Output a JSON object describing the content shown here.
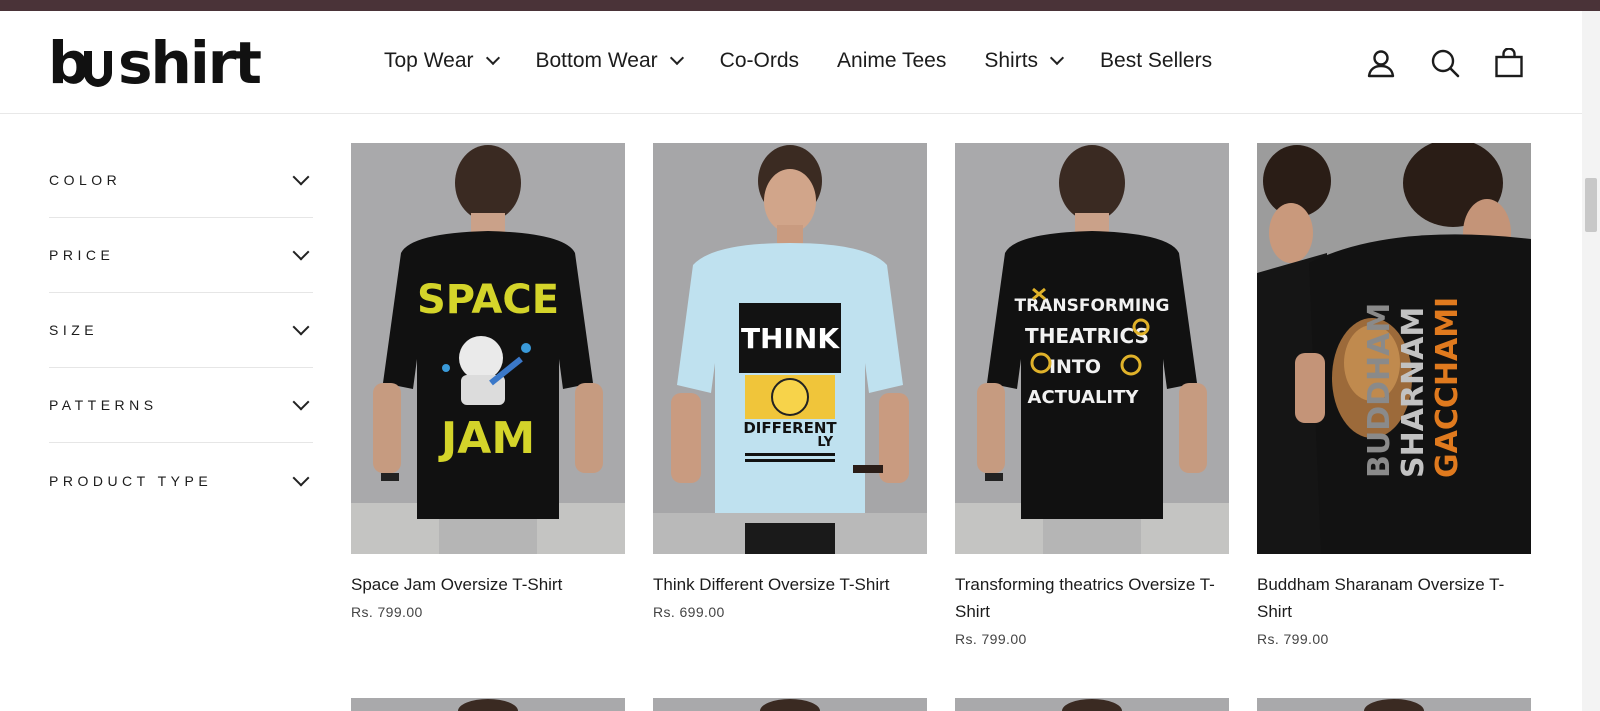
{
  "brand": {
    "logo_text": "bushirt"
  },
  "colors": {
    "topbar": "#4a3338",
    "text": "#1c1c1c",
    "divider": "#e6e6e6"
  },
  "nav": {
    "items": [
      {
        "label": "Top Wear",
        "has_dropdown": true
      },
      {
        "label": "Bottom Wear",
        "has_dropdown": true
      },
      {
        "label": "Co-Ords",
        "has_dropdown": false
      },
      {
        "label": "Anime Tees",
        "has_dropdown": false
      },
      {
        "label": "Shirts",
        "has_dropdown": true
      },
      {
        "label": "Best Sellers",
        "has_dropdown": false
      }
    ]
  },
  "header_icons": [
    "account-icon",
    "search-icon",
    "cart-icon"
  ],
  "filters": [
    {
      "label": "COLOR"
    },
    {
      "label": "PRICE"
    },
    {
      "label": "SIZE"
    },
    {
      "label": "PATTERNS"
    },
    {
      "label": "PRODUCT TYPE"
    }
  ],
  "products": [
    {
      "title": "Space Jam Oversize T-Shirt",
      "price": "Rs. 799.00",
      "image": "space-jam-tshirt-back",
      "print_text": [
        "SPACE",
        "JAM"
      ]
    },
    {
      "title": "Think Different Oversize T-Shirt",
      "price": "Rs. 699.00",
      "image": "think-different-tshirt-front",
      "print_text": [
        "THINK",
        "DIFFERENT",
        "LY"
      ]
    },
    {
      "title": "Transforming theatrics Oversize T-Shirt",
      "price": "Rs. 799.00",
      "image": "transforming-theatrics-tshirt-back",
      "print_text": [
        "TRANSFORMING",
        "THEATRICS",
        "INTO",
        "ACTUALITY"
      ]
    },
    {
      "title": "Buddham Sharanam Oversize T-Shirt",
      "price": "Rs. 799.00",
      "image": "buddham-sharanam-tshirt-back",
      "print_text": [
        "BUDDHAM",
        "SHARNAM",
        "GACCHAMI"
      ]
    }
  ]
}
